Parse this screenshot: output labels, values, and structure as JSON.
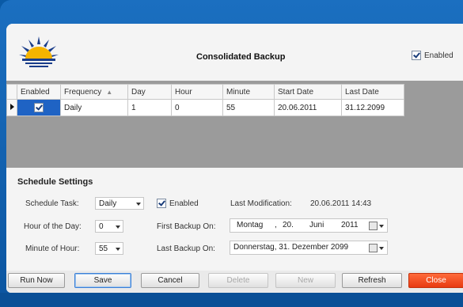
{
  "window": {
    "title": "Consolidated Backup",
    "enabled_label": "Enabled",
    "enabled_checked": true
  },
  "grid": {
    "columns": [
      "Enabled",
      "Frequency",
      "Day",
      "Hour",
      "Minute",
      "Start Date",
      "Last Date"
    ],
    "rows": [
      {
        "enabled": true,
        "frequency": "Daily",
        "day": "1",
        "hour": "0",
        "minute": "55",
        "start_date": "20.06.2011",
        "last_date": "31.12.2099"
      }
    ]
  },
  "schedule": {
    "section_title": "Schedule Settings",
    "task_label": "Schedule Task:",
    "task_value": "Daily",
    "enabled_label": "Enabled",
    "enabled_checked": true,
    "last_mod_label": "Last Modification:",
    "last_mod_value": "20.06.2011 14:43",
    "hour_label": "Hour of the Day:",
    "hour_value": "0",
    "first_backup_label": "First Backup On:",
    "first_backup": {
      "weekday": "Montag",
      "day": "20.",
      "month": "Juni",
      "year": "2011"
    },
    "minute_label": "Minute of Hour:",
    "minute_value": "55",
    "last_backup_label": "Last Backup On:",
    "last_backup_value": "Donnerstag, 31. Dezember 2099"
  },
  "buttons": {
    "run_now": "Run Now",
    "save": "Save",
    "cancel": "Cancel",
    "delete": "Delete",
    "new": "New",
    "refresh": "Refresh",
    "close": "Close"
  },
  "colors": {
    "accent_blue": "#0b55a0",
    "selected_cell": "#1f63c4",
    "close_button": "#e83a12"
  }
}
